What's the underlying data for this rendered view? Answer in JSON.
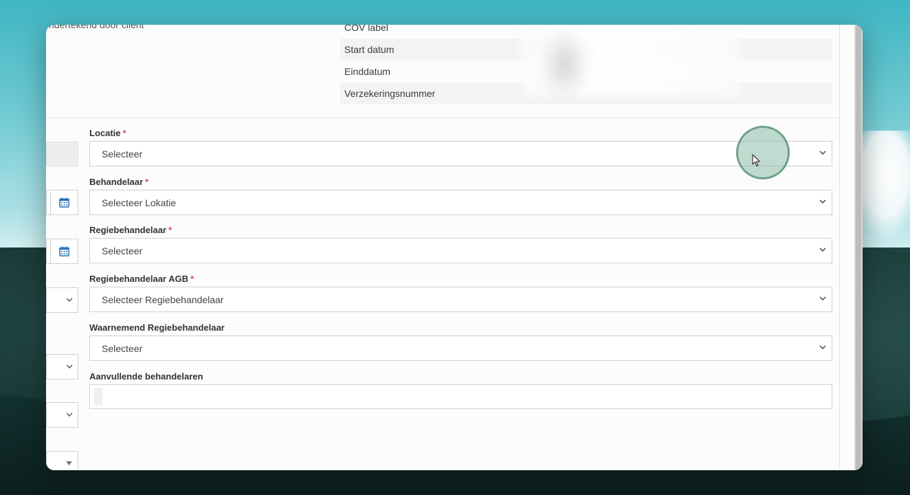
{
  "top_section": {
    "cut_label": "ndertekend door client",
    "info_rows": [
      "COV label",
      "Start datum",
      "Einddatum",
      "Verzekeringsnummer"
    ]
  },
  "form": {
    "fields": [
      {
        "label": "Locatie",
        "required": true,
        "value": "Selecteer"
      },
      {
        "label": "Behandelaar",
        "required": true,
        "value": "Selecteer Lokatie"
      },
      {
        "label": "Regiebehandelaar",
        "required": true,
        "value": "Selecteer"
      },
      {
        "label": "Regiebehandelaar AGB",
        "required": true,
        "value": "Selecteer Regiebehandelaar"
      },
      {
        "label": "Waarnemend Regiebehandelaar",
        "required": false,
        "value": "Selecteer"
      }
    ],
    "extra": {
      "label": "Aanvullende behandelaren",
      "value": ""
    },
    "required_mark": "*"
  },
  "icons": {
    "calendar": "calendar-icon",
    "chevron": "chevron-down-icon",
    "caret": "caret-down-icon",
    "pointer": "mouse-pointer-icon"
  },
  "colors": {
    "required": "#d9534f",
    "calendar_blue": "#2a72b8",
    "cursor_ring": "#78af96"
  }
}
